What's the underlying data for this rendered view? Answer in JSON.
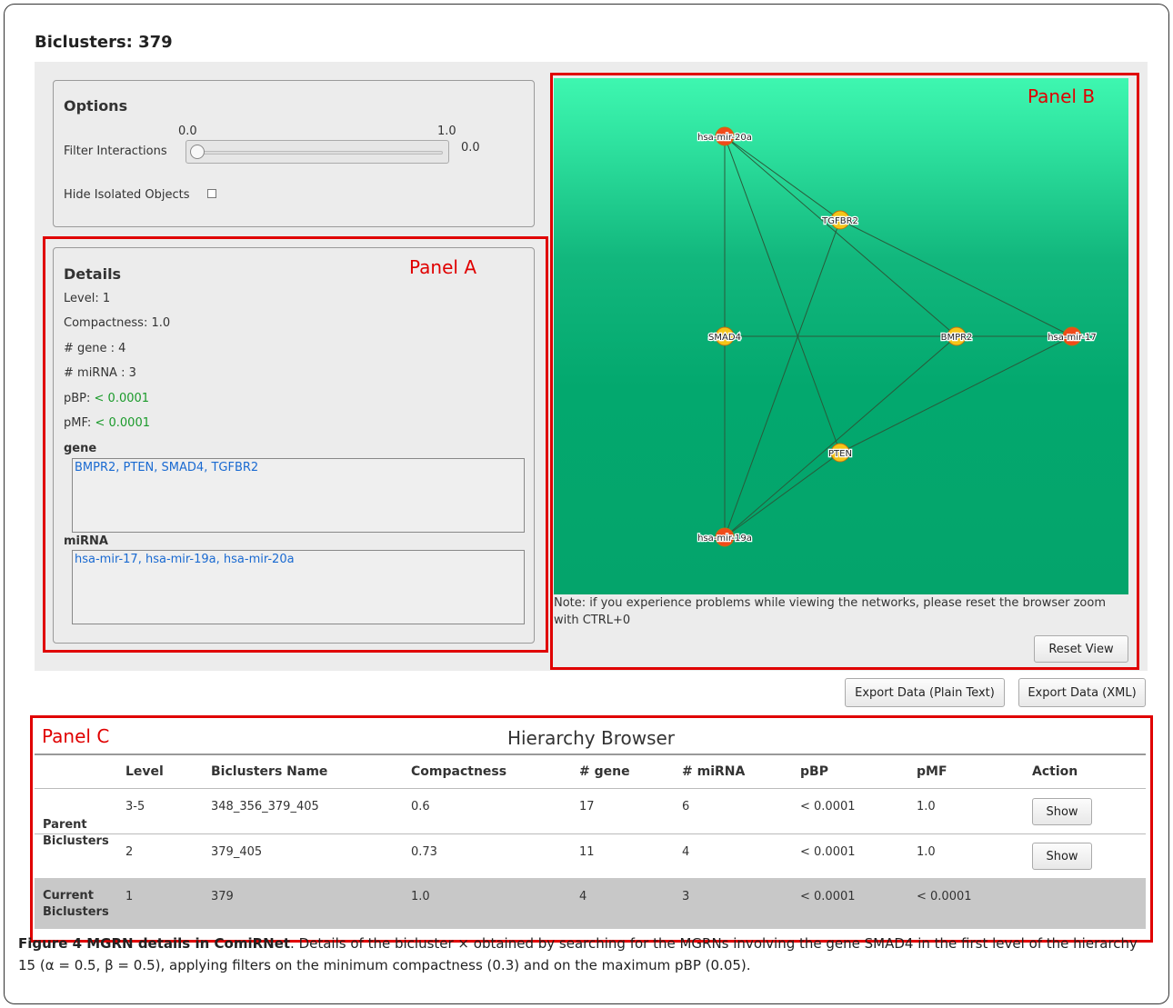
{
  "title": "Biclusters: 379",
  "panel_labels": {
    "a": "Panel A",
    "b": "Panel B",
    "c": "Panel C"
  },
  "options": {
    "heading": "Options",
    "slider_min": "0.0",
    "slider_max": "1.0",
    "filter_label": "Filter Interactions",
    "filter_value": "0.0",
    "hide_label": "Hide Isolated Objects",
    "hide_checked": false
  },
  "details": {
    "heading": "Details",
    "level_label": "Level:",
    "level_value": "1",
    "compactness_label": "Compactness:",
    "compactness_value": "1.0",
    "gene_count_label": "# gene :",
    "gene_count_value": "4",
    "mirna_count_label": "# miRNA :",
    "mirna_count_value": "3",
    "pbp_label": "pBP:",
    "pbp_value": "< 0.0001",
    "pmf_label": "pMF:",
    "pmf_value": "< 0.0001",
    "gene_heading": "gene",
    "genes": [
      "BMPR2",
      "PTEN",
      "SMAD4",
      "TGFBR2"
    ],
    "mirna_heading": "miRNA",
    "mirnas": [
      "hsa-mir-17",
      "hsa-mir-19a",
      "hsa-mir-20a"
    ]
  },
  "network": {
    "nodes": [
      {
        "id": "hsa-mir-20a",
        "type": "mirna"
      },
      {
        "id": "TGFBR2",
        "type": "gene"
      },
      {
        "id": "SMAD4",
        "type": "gene"
      },
      {
        "id": "BMPR2",
        "type": "gene"
      },
      {
        "id": "hsa-mir-17",
        "type": "mirna"
      },
      {
        "id": "PTEN",
        "type": "gene"
      },
      {
        "id": "hsa-mir-19a",
        "type": "mirna"
      }
    ],
    "edges": [
      [
        "hsa-mir-20a",
        "TGFBR2"
      ],
      [
        "hsa-mir-20a",
        "SMAD4"
      ],
      [
        "hsa-mir-20a",
        "BMPR2"
      ],
      [
        "hsa-mir-20a",
        "PTEN"
      ],
      [
        "hsa-mir-17",
        "TGFBR2"
      ],
      [
        "hsa-mir-17",
        "SMAD4"
      ],
      [
        "hsa-mir-17",
        "BMPR2"
      ],
      [
        "hsa-mir-17",
        "PTEN"
      ],
      [
        "hsa-mir-19a",
        "TGFBR2"
      ],
      [
        "hsa-mir-19a",
        "SMAD4"
      ],
      [
        "hsa-mir-19a",
        "BMPR2"
      ],
      [
        "hsa-mir-19a",
        "PTEN"
      ]
    ],
    "colors": {
      "gene": "#f5c518",
      "mirna": "#f04a1a",
      "edge": "#2a5a3a"
    },
    "note": "Note: if you experience problems while viewing the networks, please reset the browser zoom with CTRL+0",
    "reset_label": "Reset View"
  },
  "export": {
    "plain_label": "Export Data (Plain Text)",
    "xml_label": "Export Data (XML)"
  },
  "hierarchy": {
    "title": "Hierarchy Browser",
    "columns": [
      "Level",
      "Biclusters Name",
      "Compactness",
      "# gene",
      "# miRNA",
      "pBP",
      "pMF",
      "Action"
    ],
    "parent_label_1": "Parent",
    "parent_label_2": "Biclusters",
    "current_label_1": "Current",
    "current_label_2": "Biclusters",
    "rows": [
      {
        "level": "3-5",
        "name": "348_356_379_405",
        "compactness": "0.6",
        "gene": "17",
        "mirna": "6",
        "pbp": "< 0.0001",
        "pmf": "1.0",
        "action": "Show"
      },
      {
        "level": "2",
        "name": "379_405",
        "compactness": "0.73",
        "gene": "11",
        "mirna": "4",
        "pbp": "< 0.0001",
        "pmf": "1.0",
        "action": "Show"
      },
      {
        "level": "1",
        "name": "379",
        "compactness": "1.0",
        "gene": "4",
        "mirna": "3",
        "pbp": "< 0.0001",
        "pmf": "< 0.0001",
        "action": ""
      }
    ]
  },
  "caption": {
    "bold": "Figure 4 MGRN details in ComiRNet",
    "text": ". Details of the bicluster × obtained by searching for the MGRNs involving the gene SMAD4 in the first level of the hierarchy 15 (α = 0.5, β = 0.5), applying filters on the minimum compactness (0.3) and on the maximum pBP (0.05)."
  }
}
